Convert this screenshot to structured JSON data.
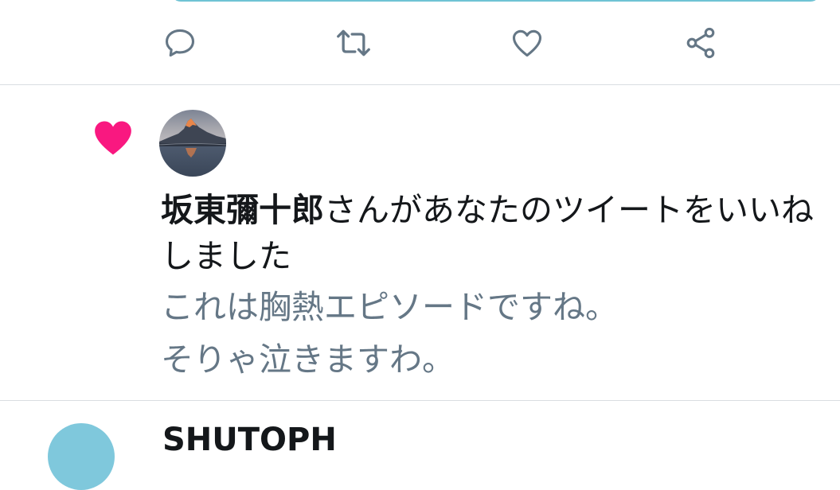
{
  "actions": {
    "reply_icon": "reply-icon",
    "retweet_icon": "retweet-icon",
    "like_icon": "like-icon",
    "share_icon": "share-icon"
  },
  "notification": {
    "icon": "heart-icon",
    "icon_color": "#f91880",
    "user_name": "坂東彌十郎",
    "action_text": "さんがあなたのツイートをいいねしました",
    "quote_lines": [
      "これは胸熱エピソードですね。",
      "そりゃ泣きますわ。"
    ]
  },
  "next_item": {
    "user_name": "SHUTOPH"
  },
  "colors": {
    "text_primary": "#14171a",
    "text_secondary": "#657786",
    "icon_gray": "#657786",
    "divider": "#d9dde1",
    "like_pink": "#f91880"
  }
}
